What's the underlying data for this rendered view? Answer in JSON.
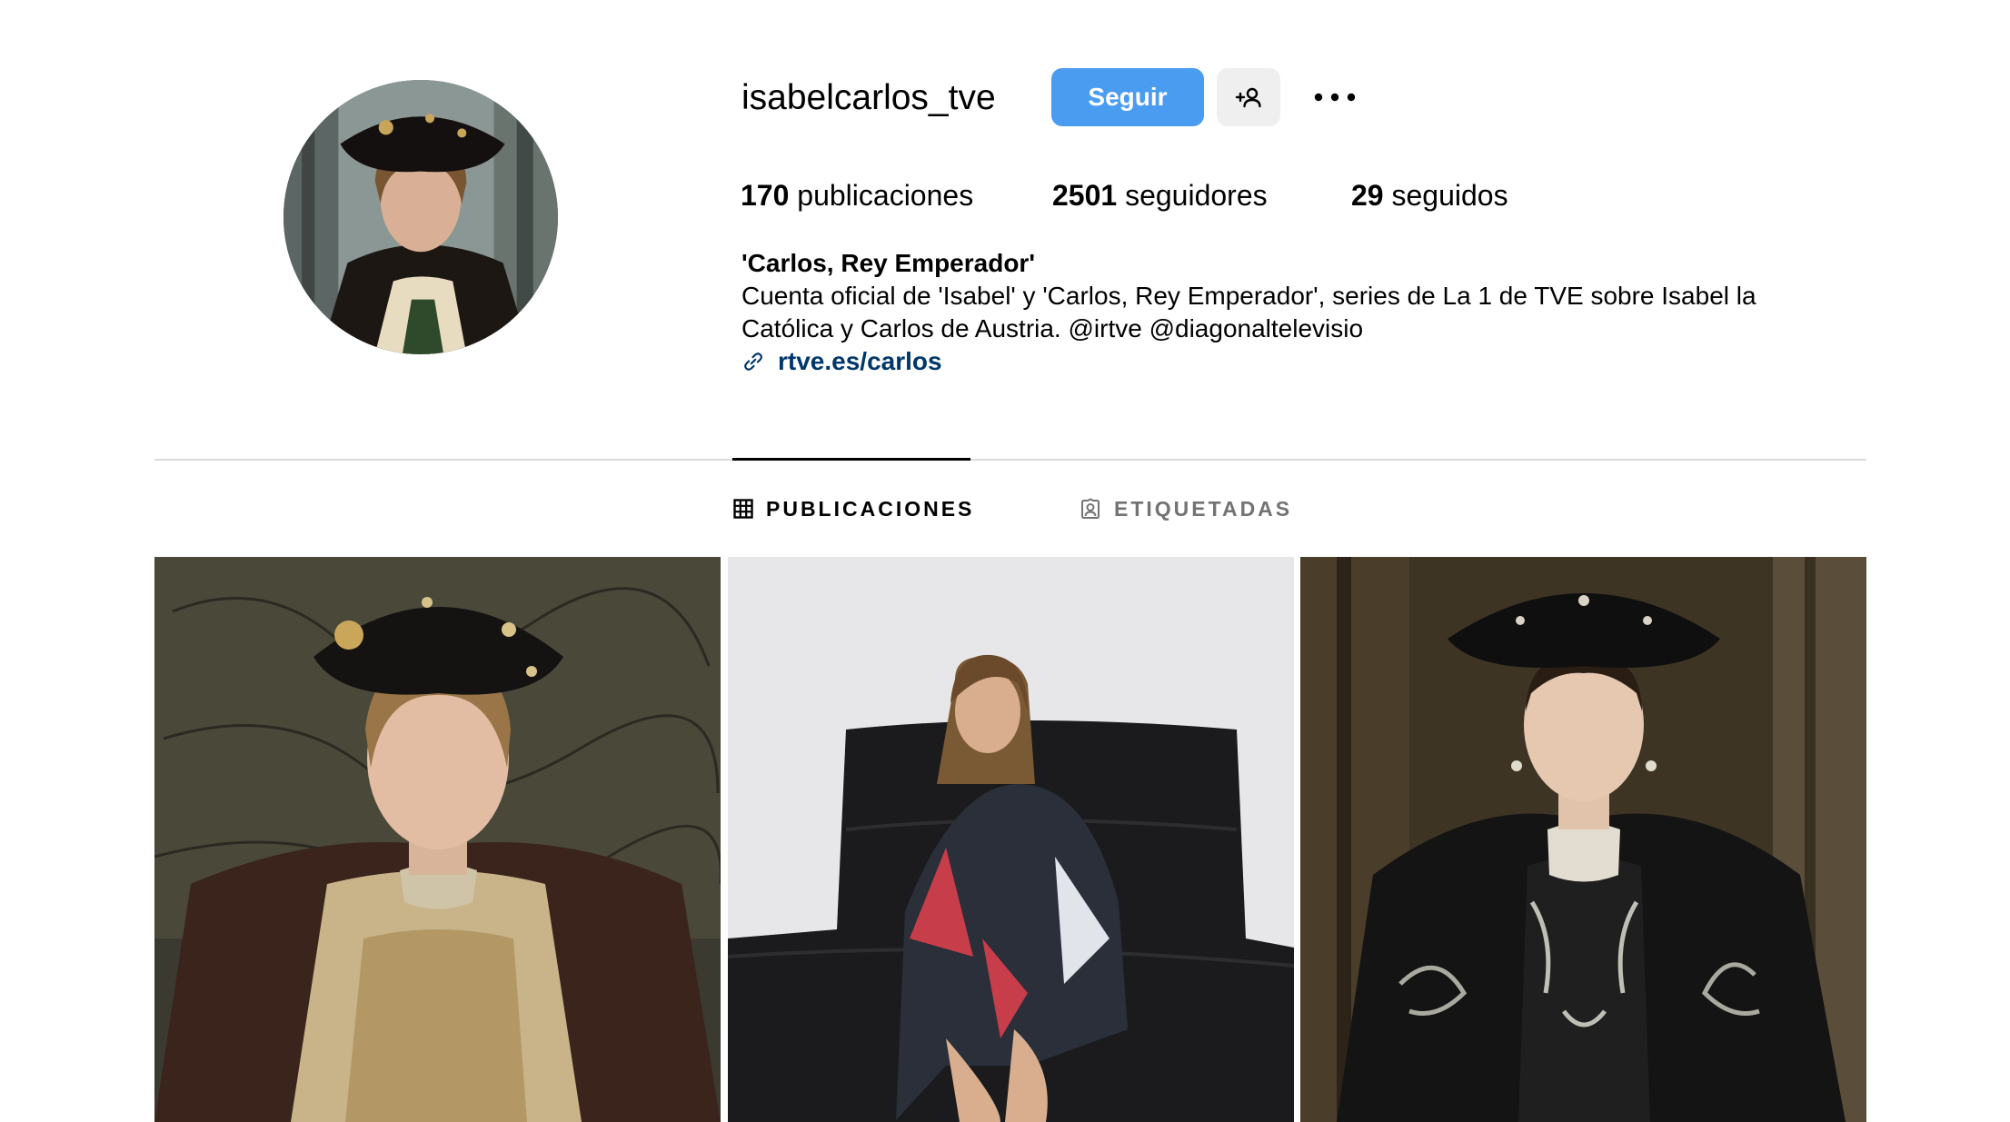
{
  "profile": {
    "username": "isabelcarlos_tve",
    "follow_label": "Seguir",
    "stats": {
      "posts_count": "170",
      "posts_label": "publicaciones",
      "followers_count": "2501",
      "followers_label": "seguidores",
      "following_count": "29",
      "following_label": "seguidos"
    },
    "bio": {
      "name": "'Carlos, Rey Emperador'",
      "text": "Cuenta oficial de 'Isabel' y 'Carlos, Rey Emperador', series de La 1 de TVE sobre Isabel la Católica y Carlos de Austria. @irtve @diagonaltelevisio",
      "link": "rtve.es/carlos"
    }
  },
  "tabs": [
    {
      "label": "PUBLICACIONES",
      "icon": "grid-icon",
      "active": true
    },
    {
      "label": "ETIQUETADAS",
      "icon": "tagged-user-icon",
      "active": false
    }
  ],
  "colors": {
    "accent": "#4a9cf1",
    "link": "#00376b",
    "divider": "#dbdbdb",
    "secondary_text": "#737373"
  },
  "posts": [
    {
      "icon": "post-photo-carlos"
    },
    {
      "icon": "post-photo-woman-on-sofa"
    },
    {
      "icon": "post-photo-isabel"
    }
  ]
}
